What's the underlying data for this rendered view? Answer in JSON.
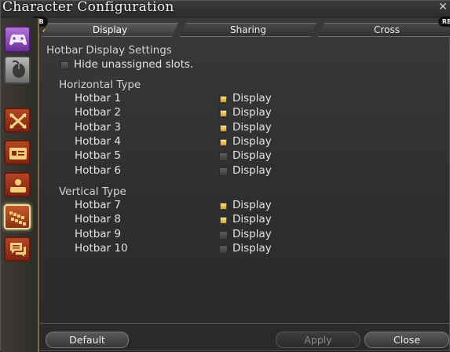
{
  "window": {
    "title": "Character Configuration",
    "close_glyph": "✕"
  },
  "badges": {
    "lb": "LB",
    "rb": "RB"
  },
  "tabs": [
    {
      "label": "Display",
      "active": true
    },
    {
      "label": "Sharing",
      "active": false
    },
    {
      "label": "Cross",
      "active": false
    }
  ],
  "sidebar": {
    "items": [
      {
        "icon": "gamepad-icon"
      },
      {
        "icon": "mouse-icon"
      },
      {
        "icon": "crossed-swords-icon"
      },
      {
        "icon": "id-card-icon"
      },
      {
        "icon": "nameplate-icon"
      },
      {
        "icon": "hotbar-icon",
        "selected": true
      },
      {
        "icon": "chat-bubbles-icon"
      }
    ]
  },
  "settings": {
    "heading": "Hotbar Display Settings",
    "hide_unassigned": {
      "label": "Hide unassigned slots.",
      "checked": false
    },
    "horizontal": {
      "heading": "Horizontal Type",
      "rows": [
        {
          "name": "Hotbar 1",
          "option": "Display",
          "checked": true
        },
        {
          "name": "Hotbar 2",
          "option": "Display",
          "checked": true
        },
        {
          "name": "Hotbar 3",
          "option": "Display",
          "checked": true
        },
        {
          "name": "Hotbar 4",
          "option": "Display",
          "checked": true
        },
        {
          "name": "Hotbar 5",
          "option": "Display",
          "checked": false
        },
        {
          "name": "Hotbar 6",
          "option": "Display",
          "checked": false
        }
      ]
    },
    "vertical": {
      "heading": "Vertical Type",
      "rows": [
        {
          "name": "Hotbar 7",
          "option": "Display",
          "checked": true
        },
        {
          "name": "Hotbar 8",
          "option": "Display",
          "checked": true
        },
        {
          "name": "Hotbar 9",
          "option": "Display",
          "checked": false
        },
        {
          "name": "Hotbar 10",
          "option": "Display",
          "checked": false
        }
      ]
    }
  },
  "footer": {
    "default": "Default",
    "apply": "Apply",
    "close": "Close"
  },
  "colors": {
    "accent": "#e1b02d",
    "sidebar_red": "#a53a1e",
    "gamepad_purple": "#9b4fc7"
  }
}
